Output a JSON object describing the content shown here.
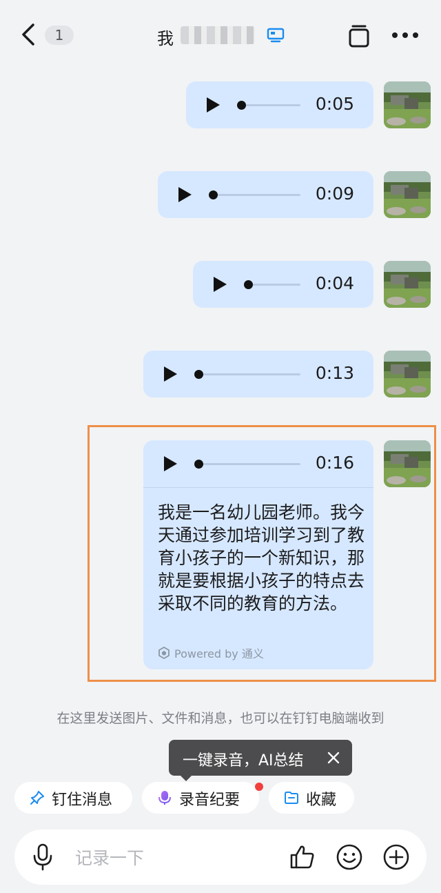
{
  "header": {
    "unread_count": "1",
    "title": "我"
  },
  "messages": [
    {
      "type": "voice",
      "duration": "0:05"
    },
    {
      "type": "voice",
      "duration": "0:09"
    },
    {
      "type": "voice",
      "duration": "0:04"
    },
    {
      "type": "voice",
      "duration": "0:13"
    },
    {
      "type": "voice",
      "duration": "0:16",
      "transcript": "我是一名幼儿园老师。我今天通过参加培训学习到了教育小孩子的一个新知识，那就是要根据小孩子的特点去采取不同的教育的方法。",
      "powered_by": "Powered by 通义"
    }
  ],
  "hint": "在这里发送图片、文件和消息，也可以在钉钉电脑端收到",
  "tooltip": {
    "text": "一键录音，AI总结"
  },
  "quick_actions": [
    {
      "label": "钉住消息",
      "icon": "pin-icon"
    },
    {
      "label": "录音纪要",
      "icon": "voice-summary-icon",
      "has_dot": true
    },
    {
      "label": "收藏",
      "icon": "favorites-folder-icon"
    }
  ],
  "input": {
    "placeholder": "记录一下"
  },
  "colors": {
    "bubble": "#d6e8ff",
    "highlight": "#ee8f48",
    "background": "#f2f3f5",
    "accent_blue": "#1a8cf0"
  }
}
